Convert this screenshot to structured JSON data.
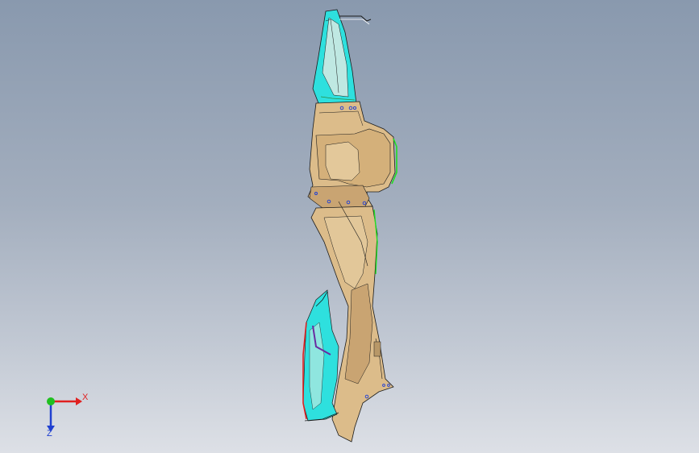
{
  "viewport": {
    "background_top": "#8999ae",
    "background_bottom": "#dde0e6"
  },
  "model": {
    "colors": {
      "body": "#dcbc8a",
      "body_shadow": "#b89868",
      "cyan_face": "#2ee0de",
      "edge_green": "#22dd22",
      "edge_red": "#dd2222",
      "edge_purple": "#6a2ca0",
      "hole_marks": "#1a3cd8"
    }
  },
  "triad": {
    "x_label": "X",
    "z_label": "Z",
    "x_color": "#e02020",
    "y_color": "#20c020",
    "z_color": "#2040d0"
  }
}
